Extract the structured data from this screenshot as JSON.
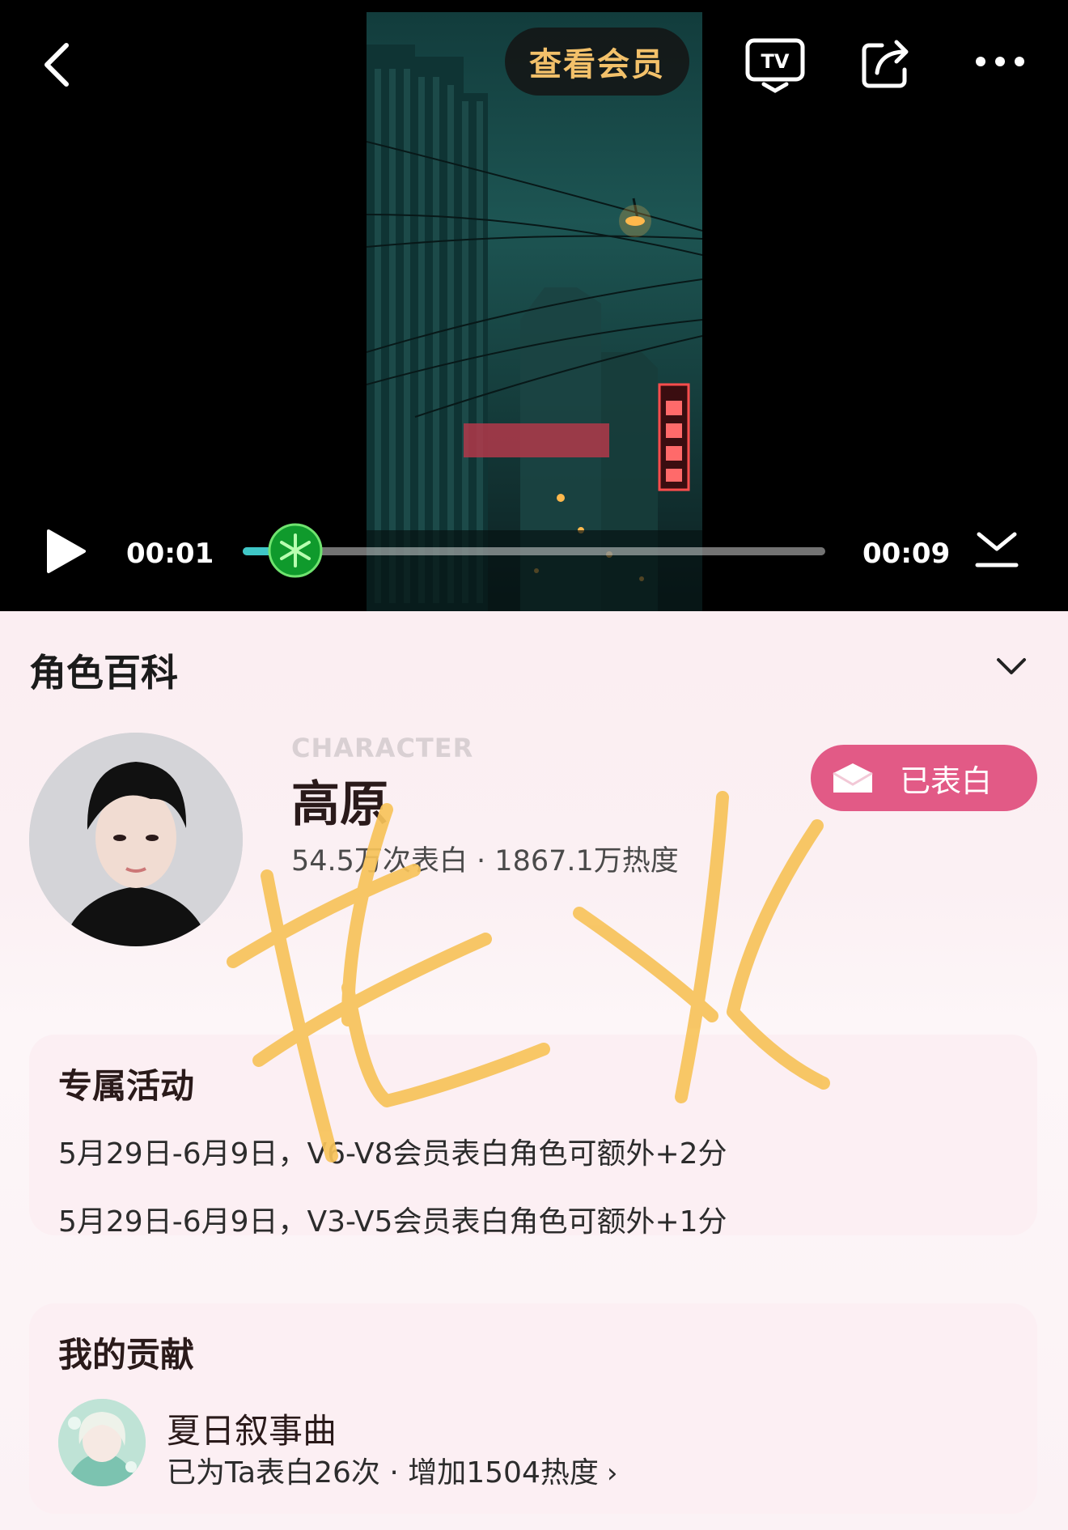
{
  "header": {
    "member_label": "查看会员",
    "back_icon": "chevron-left-icon",
    "tv_icon": "tv-cast-icon",
    "share_icon": "share-icon",
    "more_icon": "more-icon"
  },
  "player": {
    "current_time": "00:01",
    "total_time": "00:09",
    "progress": 0.09,
    "state": "paused"
  },
  "wiki": {
    "section_title": "角色百科",
    "character": {
      "label_en": "CHARACTER",
      "name": "高原",
      "stats": "54.5万次表白 · 1867.1万热度",
      "confess_label": "已表白"
    }
  },
  "activity": {
    "title": "专属活动",
    "lines": [
      "5月29日-6月9日，V6-V8会员表白角色可额外+2分",
      "5月29日-6月9日，V3-V5会员表白角色可额外+1分"
    ]
  },
  "contribution": {
    "title": "我的贡献",
    "user_name": "夏日叙事曲",
    "detail": "已为Ta表白26次 · 增加1504热度"
  },
  "colors": {
    "accent_pink": "#e25a86",
    "member_gold": "#f3c16a",
    "progress_teal": "#3fc7c7",
    "watermark_yellow": "#f7c35a"
  },
  "watermark_text": "花火"
}
